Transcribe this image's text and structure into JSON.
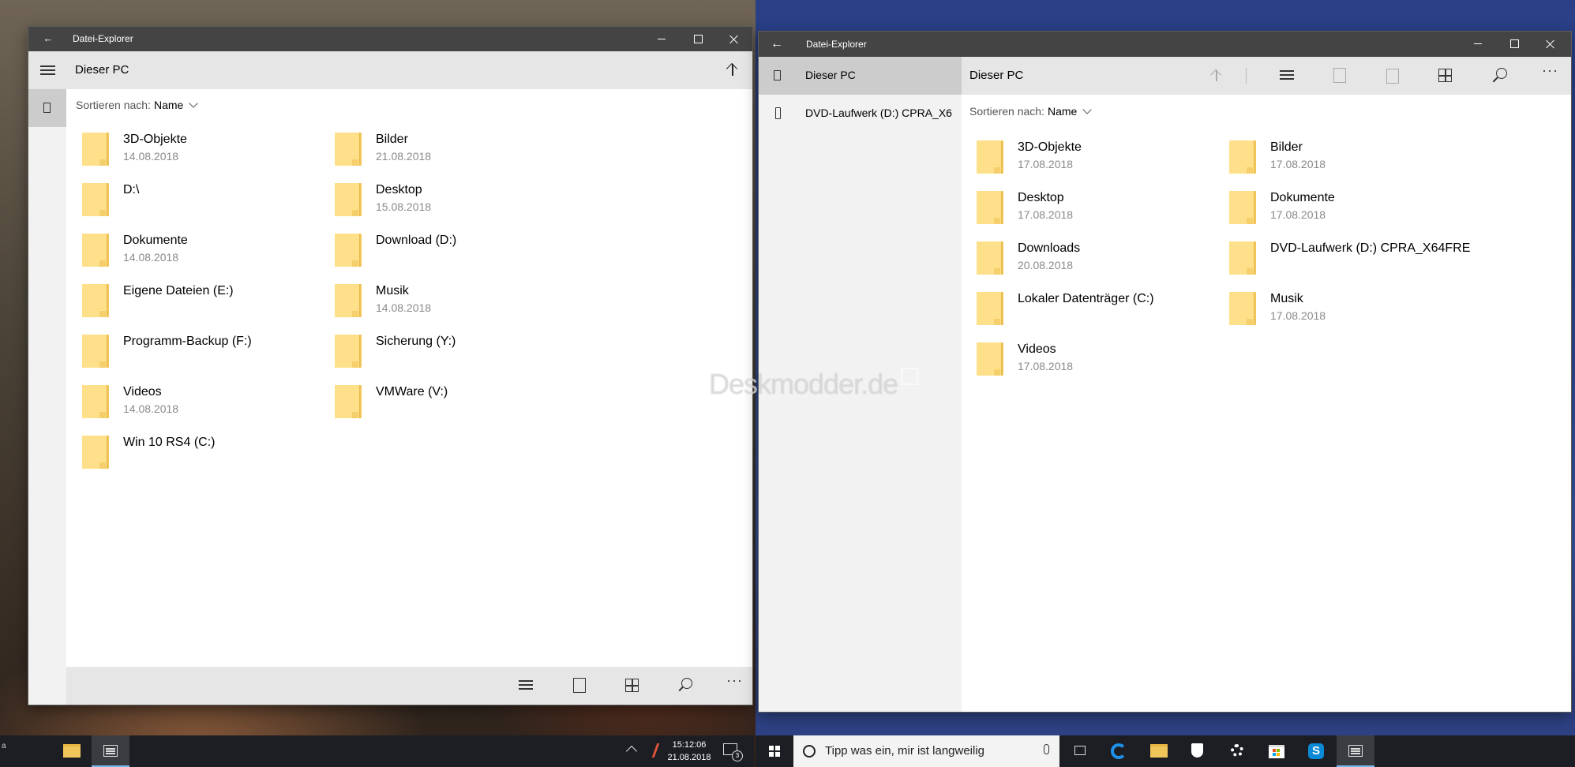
{
  "left_window": {
    "title": "Datei-Explorer",
    "back_glyph": "←",
    "address": "Dieser PC",
    "sort_label": "Sortieren nach:",
    "sort_value": "Name",
    "items": [
      {
        "name": "3D-Objekte",
        "date": "14.08.2018"
      },
      {
        "name": "Bilder",
        "date": "21.08.2018"
      },
      {
        "name": "D:\\",
        "date": ""
      },
      {
        "name": "Desktop",
        "date": "15.08.2018"
      },
      {
        "name": "Dokumente",
        "date": "14.08.2018"
      },
      {
        "name": "Download (D:)",
        "date": ""
      },
      {
        "name": "Eigene Dateien (E:)",
        "date": ""
      },
      {
        "name": "Musik",
        "date": "14.08.2018"
      },
      {
        "name": "Programm-Backup (F:)",
        "date": ""
      },
      {
        "name": "Sicherung (Y:)",
        "date": ""
      },
      {
        "name": "Videos",
        "date": "14.08.2018"
      },
      {
        "name": "VMWare (V:)",
        "date": ""
      },
      {
        "name": "Win 10 RS4 (C:)",
        "date": ""
      }
    ],
    "more_glyph": "···"
  },
  "right_window": {
    "title": "Datei-Explorer",
    "back_glyph": "←",
    "nav": [
      {
        "label": "Dieser PC"
      },
      {
        "label": "DVD-Laufwerk (D:) CPRA_X6"
      }
    ],
    "address": "Dieser PC",
    "sort_label": "Sortieren nach:",
    "sort_value": "Name",
    "items": [
      {
        "name": "3D-Objekte",
        "date": "17.08.2018"
      },
      {
        "name": "Bilder",
        "date": "17.08.2018"
      },
      {
        "name": "Desktop",
        "date": "17.08.2018"
      },
      {
        "name": "Dokumente",
        "date": "17.08.2018"
      },
      {
        "name": "Downloads",
        "date": "20.08.2018"
      },
      {
        "name": "DVD-Laufwerk (D:) CPRA_X64FRE",
        "date": ""
      },
      {
        "name": "Lokaler Datenträger (C:)",
        "date": ""
      },
      {
        "name": "Musik",
        "date": "17.08.2018"
      },
      {
        "name": "Videos",
        "date": "17.08.2018"
      }
    ],
    "more_glyph": "···"
  },
  "watermark": "Deskmodder.de",
  "left_taskbar": {
    "start_glyph": "a",
    "tray_chevron": "^",
    "time": "15:12:06",
    "date": "21.08.2018",
    "notification_count": "3"
  },
  "right_taskbar": {
    "search_placeholder": "Tipp was ein, mir ist langweilig"
  },
  "colors": {
    "titlebar": "#444444",
    "address_bar": "#e6e6e6",
    "nav_pane": "#f2f2f2",
    "nav_selected": "#cccccc",
    "folder": "#ffe08a",
    "taskbar": "#1c1e24",
    "accent": "#0078d7"
  }
}
